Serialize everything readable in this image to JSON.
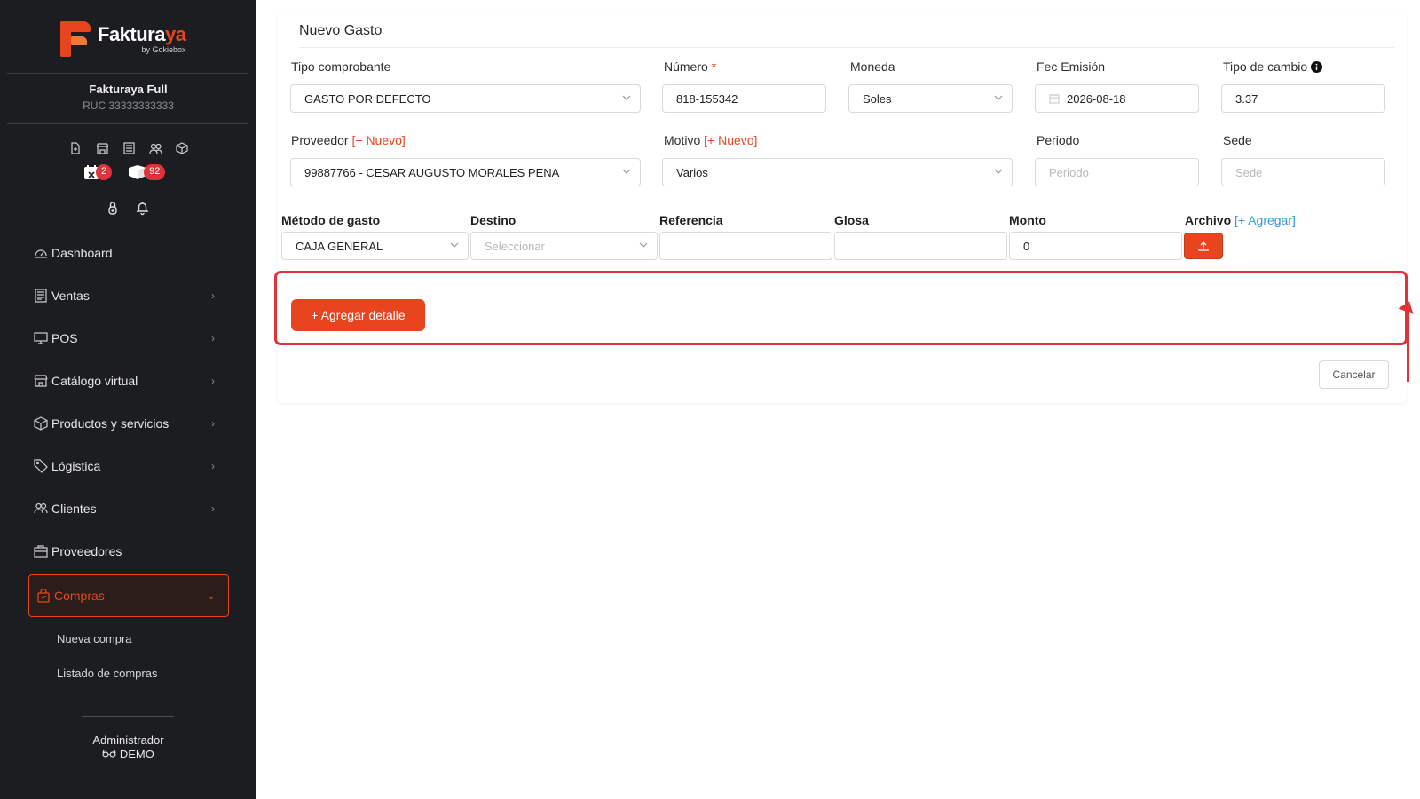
{
  "brand": {
    "name_main": "Faktura",
    "name_accent": "ya",
    "byline": "by Gokiebox",
    "accent_color": "#e8451f"
  },
  "company": {
    "name": "Fakturaya Full",
    "ruc": "RUC 33333333333"
  },
  "quick_icons": [
    "new-document-icon",
    "store-icon",
    "list-icon",
    "users-icon",
    "box-icon"
  ],
  "badges": [
    {
      "icon": "calendar-x-icon",
      "count": "2"
    },
    {
      "icon": "boxes-icon",
      "count": "92"
    }
  ],
  "user_icons": [
    "lock-icon",
    "bell-icon"
  ],
  "menu": {
    "items": [
      {
        "label": "Dashboard",
        "icon": "dashboard-icon",
        "chevron": false
      },
      {
        "label": "Ventas",
        "icon": "receipt-icon",
        "chevron": true
      },
      {
        "label": "POS",
        "icon": "monitor-icon",
        "chevron": true
      },
      {
        "label": "Catálogo virtual",
        "icon": "store-icon",
        "chevron": true
      },
      {
        "label": "Productos y servicios",
        "icon": "box-icon",
        "chevron": true
      },
      {
        "label": "Lógistica",
        "icon": "tag-icon",
        "chevron": true
      },
      {
        "label": "Clientes",
        "icon": "users-icon",
        "chevron": true
      },
      {
        "label": "Proveedores",
        "icon": "briefcase-icon",
        "chevron": false
      }
    ],
    "active": {
      "label": "Compras",
      "icon": "shopping-bag-icon"
    },
    "submenu": [
      "Nueva compra",
      "Listado de compras"
    ]
  },
  "footer": {
    "role": "Administrador",
    "mode": "DEMO"
  },
  "form": {
    "title": "Nuevo Gasto",
    "tipo_comprobante": {
      "label": "Tipo comprobante",
      "value": "GASTO POR DEFECTO"
    },
    "numero": {
      "label": "Número",
      "required_mark": "*",
      "value": "818-155342"
    },
    "moneda": {
      "label": "Moneda",
      "value": "Soles"
    },
    "fec_emision": {
      "label": "Fec Emisión",
      "value": "2026-08-18"
    },
    "tipo_cambio": {
      "label": "Tipo de cambio",
      "value": "3.37"
    },
    "proveedor": {
      "label": "Proveedor",
      "link": "[+ Nuevo]",
      "value": "99887766 - CESAR AUGUSTO MORALES PENA"
    },
    "motivo": {
      "label": "Motivo",
      "link": "[+ Nuevo]",
      "value": "Varios"
    },
    "periodo": {
      "label": "Periodo",
      "placeholder": "Periodo"
    },
    "sede": {
      "label": "Sede",
      "placeholder": "Sede"
    },
    "metodo": {
      "label": "Método de gasto",
      "value": "CAJA GENERAL"
    },
    "destino": {
      "label": "Destino",
      "placeholder": "Seleccionar"
    },
    "referencia": {
      "label": "Referencia",
      "value": ""
    },
    "glosa": {
      "label": "Glosa",
      "value": ""
    },
    "monto": {
      "label": "Monto",
      "value": "0"
    },
    "archivo": {
      "label": "Archivo",
      "link": "[+ Agregar]"
    },
    "add_detail_label": "+ Agregar detalle",
    "cancel_label": "Cancelar"
  },
  "annotation_color": "#e0323a"
}
